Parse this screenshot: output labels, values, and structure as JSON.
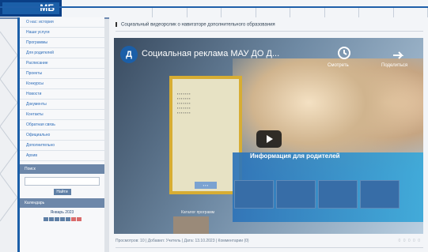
{
  "topbar": {
    "logo_text": "МБ"
  },
  "sidebar": {
    "items": [
      "О нас: история",
      "Наши услуги",
      "Программы",
      "Для родителей",
      "Расписание",
      "Проекты",
      "Конкурсы",
      "Новости",
      "Документы",
      "Контакты",
      "Обратная связь",
      "Официально",
      "Дополнительно",
      "Архив"
    ],
    "section_title": "Поиск",
    "search_button": "Найти",
    "calendar_label": "Календарь",
    "month_label": "Январь 2023"
  },
  "main": {
    "post_title": "Социальный видеоролик о навигаторе дополнительного образования",
    "video_title": "Социальная реклама МАУ ДО Д...",
    "avatar_letter": "Д",
    "watch_label": "Смотреть",
    "share_label": "Поделиться",
    "overlay_caption": "Информация для родителей",
    "bottom_caption": "Каталог программ",
    "meta_text": "Просмотров: 10 | Добавил: Учитель | Дата: 13.10.2023 | Комментарии (0)",
    "rating_text": "0 0 0 0 0"
  },
  "colors": {
    "accent": "#1b5fa8",
    "sidebar_link": "#2b6bb8",
    "header_bg": "#f3f5f8"
  }
}
